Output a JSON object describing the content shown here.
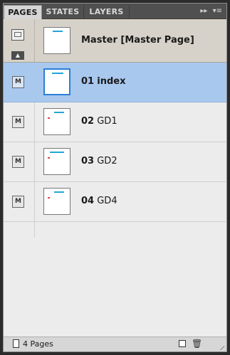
{
  "tabs": [
    {
      "label": "PAGES",
      "active": true
    },
    {
      "label": "STATES",
      "active": false
    },
    {
      "label": "LAYERS",
      "active": false
    }
  ],
  "tab_menu": {
    "forward_glyph": "▸▸",
    "menu_glyph": "▾≡"
  },
  "master": {
    "label": "Master [Master Page]",
    "icon": "master-page-icon",
    "collapse_glyph": "▲"
  },
  "pages": [
    {
      "number": "01",
      "name": "index",
      "selected": true
    },
    {
      "number": "02",
      "name": "GD1",
      "selected": false
    },
    {
      "number": "03",
      "name": "GD2",
      "selected": false
    },
    {
      "number": "04",
      "name": "GD4",
      "selected": false
    }
  ],
  "badge_glyph": "M",
  "footer": {
    "count": "4 Pages",
    "trash_glyph": "🗑"
  },
  "colors": {
    "selected_row": "#a9c8ee",
    "master_row": "#d7d2c9",
    "thumb_accent": "#22a5d8"
  }
}
